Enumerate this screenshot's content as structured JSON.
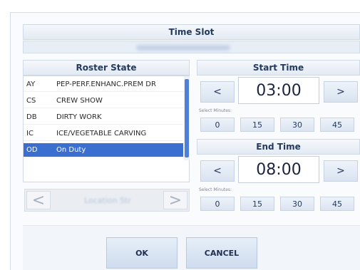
{
  "dialog": {
    "title": "Time Slot"
  },
  "roster": {
    "header": "Roster State",
    "rows": [
      {
        "code": "AY",
        "desc": "PEP-PERF.ENHANC.PREM DR"
      },
      {
        "code": "CS",
        "desc": "CREW SHOW"
      },
      {
        "code": "DB",
        "desc": "DIRTY WORK"
      },
      {
        "code": "IC",
        "desc": "ICE/VEGETABLE CARVING"
      },
      {
        "code": "OD",
        "desc": "On Duty",
        "selected": true
      }
    ],
    "location_prev": "<",
    "location_label": "Location Str",
    "location_next": ">"
  },
  "start_time": {
    "header": "Start Time",
    "prev": "<",
    "value": "03:00",
    "next": ">",
    "minutes_label": "Select Minutes:",
    "minutes": [
      "0",
      "15",
      "30",
      "45"
    ]
  },
  "end_time": {
    "header": "End Time",
    "prev": "<",
    "value": "08:00",
    "next": ">",
    "minutes_label": "Select Minutes:",
    "minutes": [
      "0",
      "15",
      "30",
      "45"
    ]
  },
  "buttons": {
    "ok": "OK",
    "cancel": "CANCEL"
  },
  "colors": {
    "selection": "#3a6fd0",
    "header_text": "#243a5e",
    "scroll_thumb": "#4f7fd6"
  }
}
